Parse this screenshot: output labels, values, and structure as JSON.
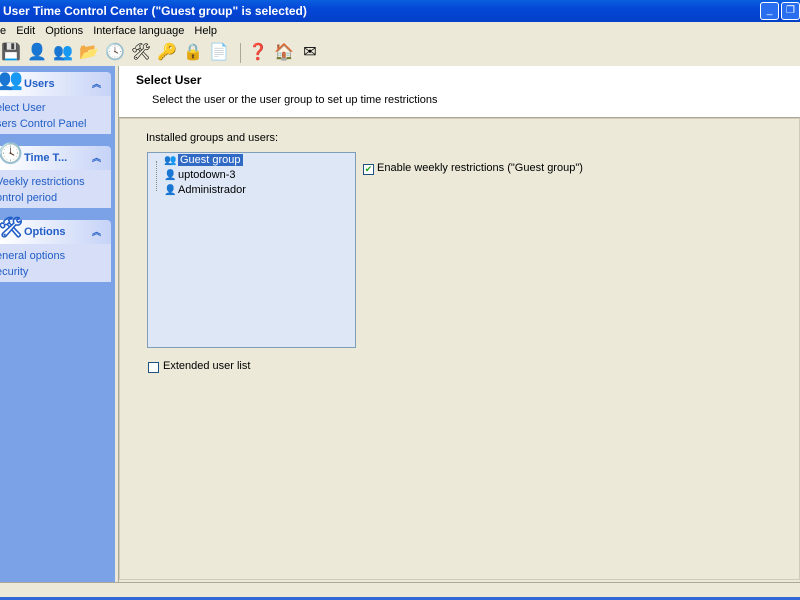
{
  "window": {
    "title": "User Time Control Center (\"Guest group\" is selected)"
  },
  "menu": [
    "e",
    "Edit",
    "Options",
    "Interface language",
    "Help"
  ],
  "toolbar": [
    {
      "icon": "save-icon",
      "glyph": "💾"
    },
    {
      "icon": "user-icon",
      "glyph": "👤"
    },
    {
      "icon": "users-icon",
      "glyph": "👥"
    },
    {
      "icon": "folder-open-icon",
      "glyph": "📂"
    },
    {
      "icon": "clock-icon",
      "glyph": "🕓"
    },
    {
      "icon": "settings-icon",
      "glyph": "🛠"
    },
    {
      "icon": "keys-icon",
      "glyph": "🔑"
    },
    {
      "icon": "lock-icon",
      "glyph": "🔒"
    },
    {
      "icon": "document-icon",
      "glyph": "📄"
    },
    {
      "icon": "help-icon",
      "glyph": "❓"
    },
    {
      "icon": "home-icon",
      "glyph": "🏠"
    },
    {
      "icon": "mail-icon",
      "glyph": "✉"
    }
  ],
  "sidebar": [
    {
      "title": "Users",
      "icon": "users-icon",
      "glyph": "👥",
      "items": [
        "elect User",
        "sers Control Panel"
      ]
    },
    {
      "title": "Time T...",
      "icon": "clock-icon",
      "glyph": "🕓",
      "items": [
        "Veekly restrictions",
        "ontrol period"
      ]
    },
    {
      "title": "Options",
      "icon": "settings-icon",
      "glyph": "🛠",
      "items": [
        "eneral options",
        "ecurity"
      ]
    }
  ],
  "main": {
    "title": "Select User",
    "subtitle": "Select the user or the user group to set up time restrictions",
    "tree_label": "Installed groups and users:",
    "tree": [
      {
        "label": "Guest group",
        "selected": true,
        "icon": "group-icon"
      },
      {
        "label": "uptodown-3",
        "icon": "user-icon"
      },
      {
        "label": "Administrador",
        "icon": "user-icon"
      }
    ],
    "weekly_label": "Enable weekly restrictions (\"Guest group\")",
    "weekly_checked": true,
    "extended_label": "Extended user list",
    "extended_checked": false
  }
}
